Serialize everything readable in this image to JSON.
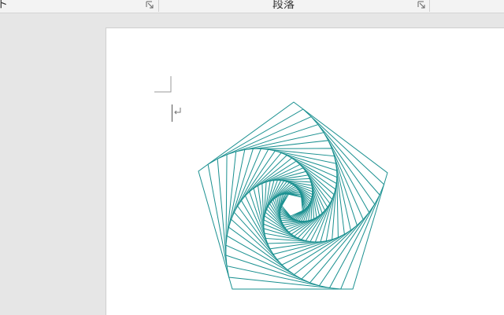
{
  "ribbon": {
    "left_group_label": "ト",
    "paragraph_group_label": "段落",
    "left_launcher_icon": "dialog-launcher-icon",
    "paragraph_launcher_icon": "dialog-launcher-icon"
  },
  "document": {
    "paragraph_mark": "↵",
    "shape": {
      "type": "rotating-pentagon-spiral",
      "stroke_color": "#1a9090",
      "layers": 34
    }
  }
}
